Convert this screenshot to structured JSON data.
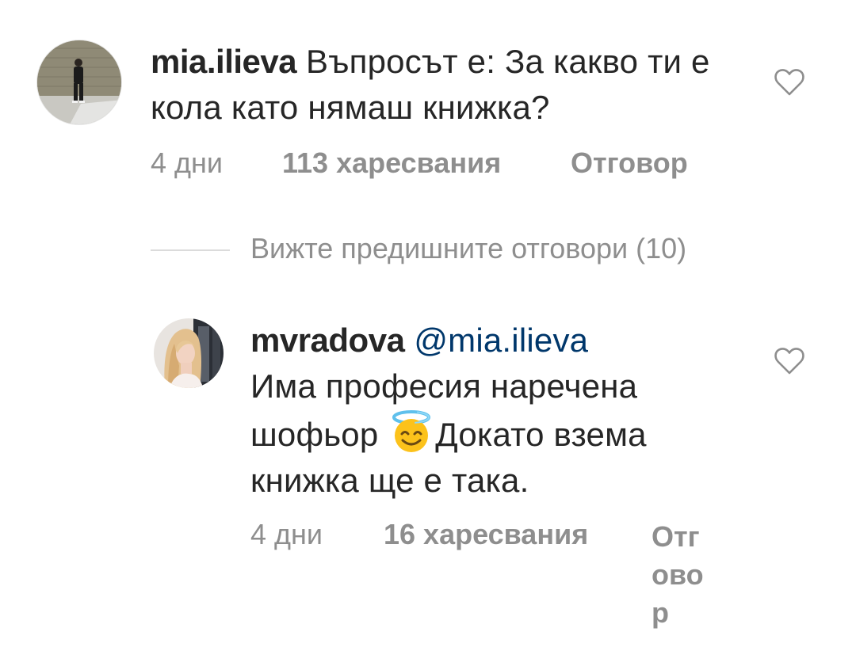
{
  "comment1": {
    "username": "mia.ilieva",
    "text": "Въпросът е: За какво ти е кола като нямаш книжка?",
    "time": "4 дни",
    "likes": "113 харесвания",
    "reply_label": "Отговор",
    "like_icon": "heart-outline-icon"
  },
  "view_previous": {
    "label": "Вижте предишните отговори (10)"
  },
  "comment2": {
    "username": "mvradova",
    "mention": "@mia.ilieva",
    "text_part1": "Има професия наречена шофьор",
    "emoji": "smiling-face-with-halo-emoji",
    "text_part2": "Докато взема книжка ще е така.",
    "time": "4 дни",
    "likes": "16 харесвания",
    "reply_label": "Отговор",
    "like_icon": "heart-outline-icon"
  },
  "colors": {
    "text": "#262626",
    "muted": "#8e8e8e",
    "mention": "#00376b",
    "divider": "#dbdbdb"
  }
}
